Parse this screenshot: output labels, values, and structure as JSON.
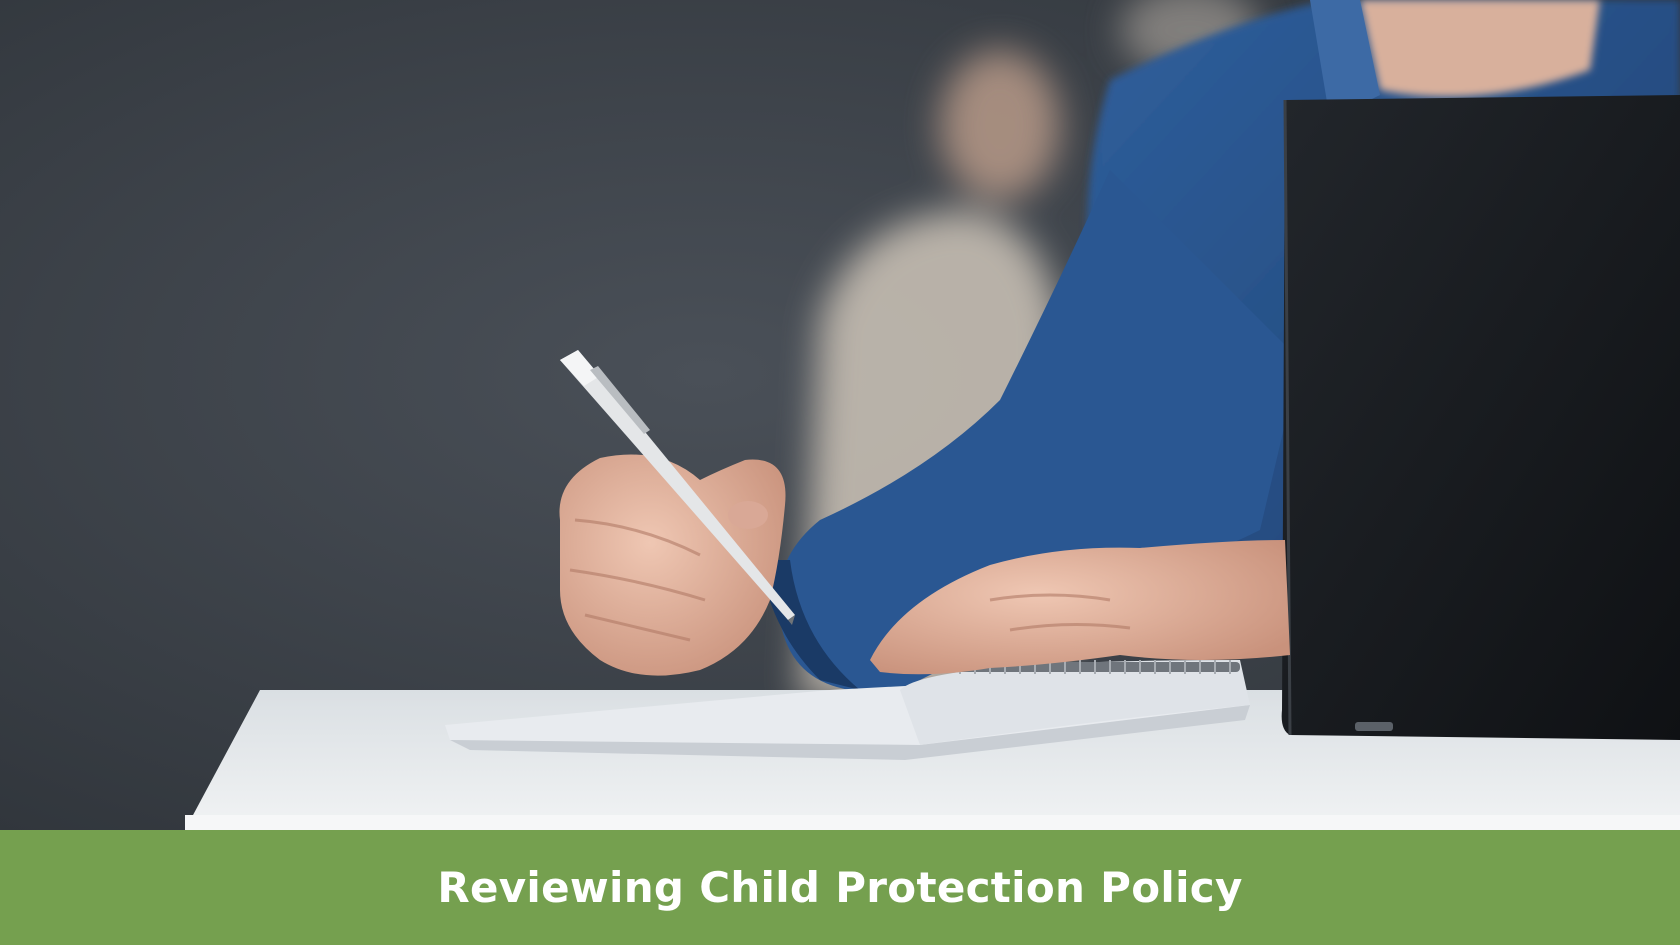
{
  "caption": {
    "text": "Reviewing Child Protection Policy"
  },
  "colors": {
    "caption_bar": "#75a04f",
    "caption_text": "#ffffff",
    "wall": "#3e444c",
    "desk": "#e9ecee",
    "jacket": "#264f86",
    "laptop": "#15181c"
  },
  "icons": {
    "pen": "pen-icon",
    "notebook": "notebook-icon",
    "laptop": "laptop-icon"
  }
}
